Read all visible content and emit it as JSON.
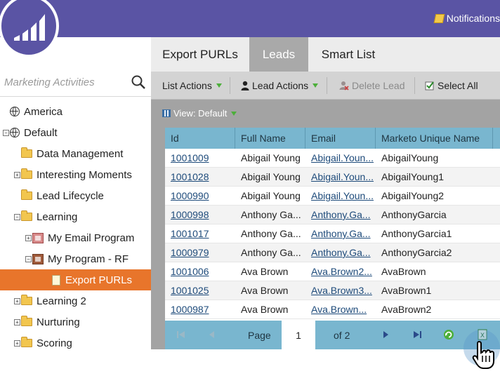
{
  "header": {
    "notifications_label": "Notifications"
  },
  "sidebar": {
    "search_placeholder": "Marketing Activities",
    "tree": [
      {
        "label": "America",
        "icon": "globe-icon",
        "toggle": "",
        "level": 0
      },
      {
        "label": "Default",
        "icon": "globe-icon",
        "toggle": "−",
        "level": 0
      },
      {
        "label": "Data Management",
        "icon": "folder-icon",
        "toggle": "",
        "level": 1
      },
      {
        "label": "Interesting Moments",
        "icon": "folder-icon",
        "toggle": "+",
        "level": 1
      },
      {
        "label": "Lead Lifecycle",
        "icon": "folder-icon",
        "toggle": "",
        "level": 1
      },
      {
        "label": "Learning",
        "icon": "folder-icon",
        "toggle": "−",
        "level": 1
      },
      {
        "label": "My Email Program",
        "icon": "email-program-icon",
        "toggle": "+",
        "level": 2
      },
      {
        "label": "My Program - RF",
        "icon": "program-icon",
        "toggle": "−",
        "level": 2
      },
      {
        "label": "Export PURLs",
        "icon": "page-icon",
        "toggle": "",
        "level": 3,
        "selected": true
      },
      {
        "label": "Learning 2",
        "icon": "folder-icon",
        "toggle": "+",
        "level": 1
      },
      {
        "label": "Nurturing",
        "icon": "folder-icon",
        "toggle": "+",
        "level": 1
      },
      {
        "label": "Scoring",
        "icon": "folder-icon",
        "toggle": "+",
        "level": 1
      }
    ]
  },
  "tabs": [
    {
      "label": "Export PURLs",
      "active": false
    },
    {
      "label": "Leads",
      "active": true
    },
    {
      "label": "Smart List",
      "active": false
    }
  ],
  "toolbar": {
    "list_actions": "List Actions",
    "lead_actions": "Lead Actions",
    "delete_lead": "Delete Lead",
    "select_all": "Select All"
  },
  "view": {
    "label": "View: Default"
  },
  "grid": {
    "columns": [
      "Id",
      "Full Name",
      "Email",
      "Marketo Unique Name"
    ],
    "rows": [
      [
        "1001009",
        "Abigail Young",
        "Abigail.Youn...",
        "AbigailYoung"
      ],
      [
        "1001028",
        "Abigail Young",
        "Abigail.Youn...",
        "AbigailYoung1"
      ],
      [
        "1000990",
        "Abigail Young",
        "Abigail.Youn...",
        "AbigailYoung2"
      ],
      [
        "1000998",
        "Anthony Ga...",
        "Anthony.Ga...",
        "AnthonyGarcia"
      ],
      [
        "1001017",
        "Anthony Ga...",
        "Anthony.Ga...",
        "AnthonyGarcia1"
      ],
      [
        "1000979",
        "Anthony Ga...",
        "Anthony.Ga...",
        "AnthonyGarcia2"
      ],
      [
        "1001006",
        "Ava Brown",
        "Ava.Brown2...",
        "AvaBrown"
      ],
      [
        "1001025",
        "Ava Brown",
        "Ava.Brown3...",
        "AvaBrown1"
      ],
      [
        "1000987",
        "Ava Brown",
        "Ava.Brown...",
        "AvaBrown2"
      ]
    ]
  },
  "pager": {
    "page_label": "Page",
    "current_page": "1",
    "of_label": "of 2"
  },
  "colors": {
    "brand": "#5a54a4",
    "selected": "#e8752b",
    "grid_header": "#79b6cf"
  }
}
